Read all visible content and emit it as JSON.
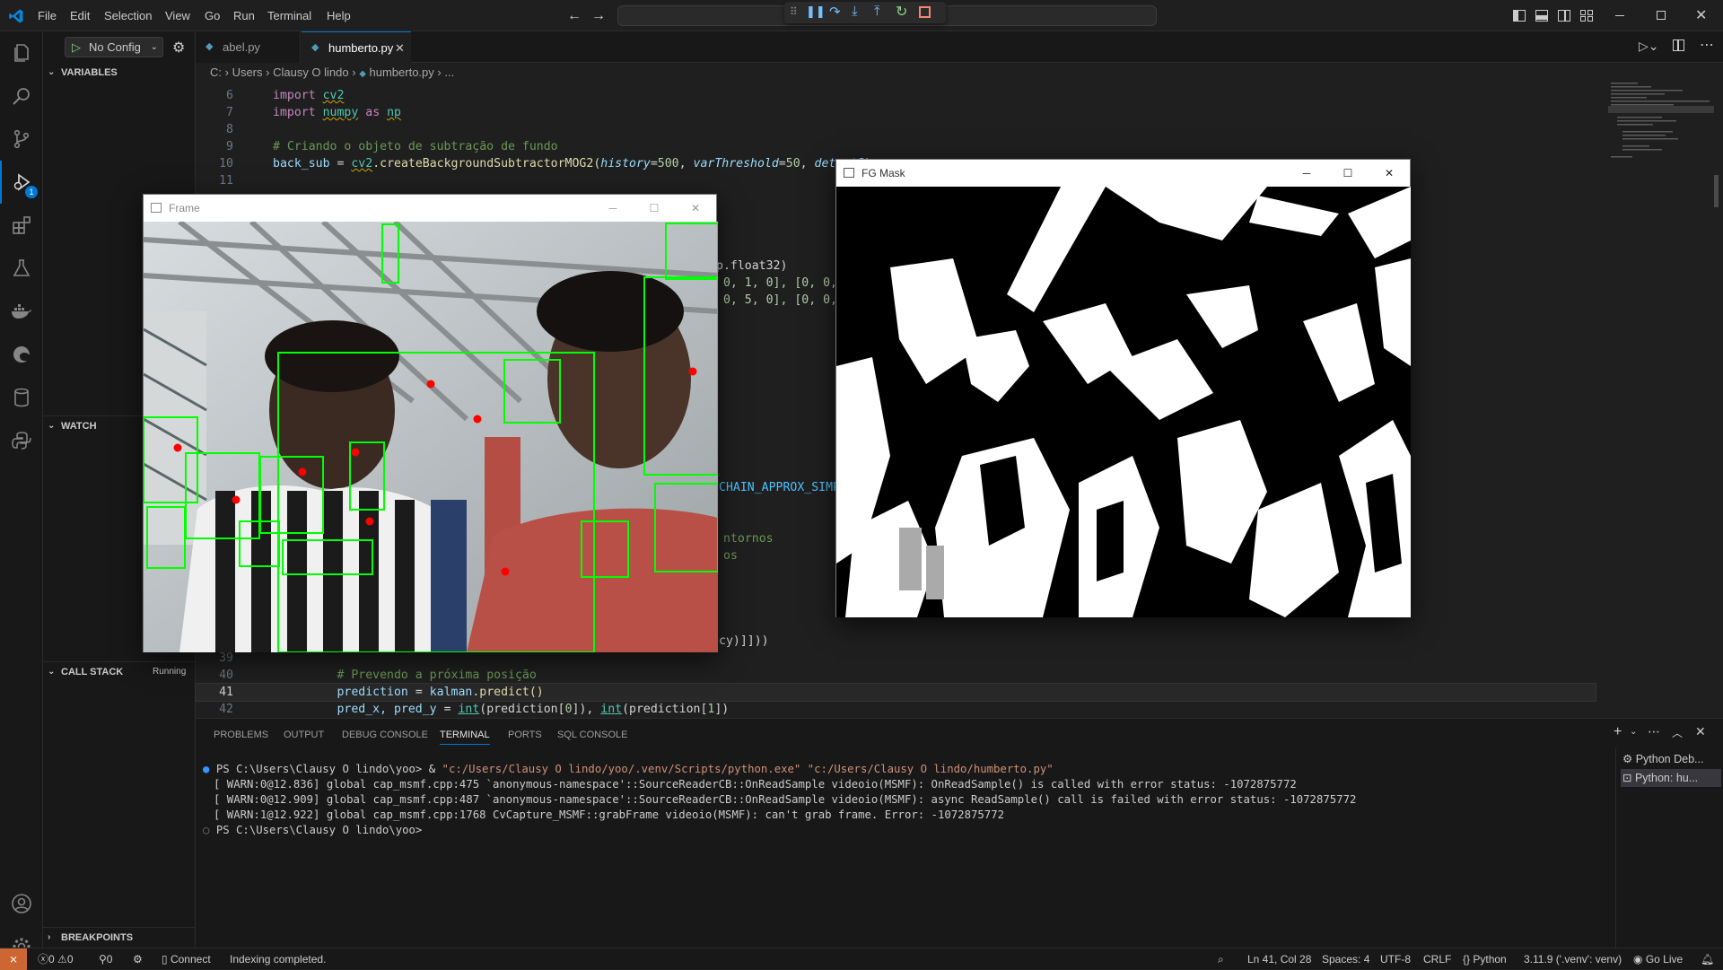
{
  "menu": [
    "File",
    "Edit",
    "Selection",
    "View",
    "Go",
    "Run",
    "Terminal",
    "Help"
  ],
  "run_config": {
    "label": "No Config"
  },
  "tabs": [
    {
      "label": "abel.py"
    },
    {
      "label": "humberto.py"
    }
  ],
  "breadcrumb": {
    "parts": [
      "C:",
      "Users",
      "Clausy O lindo",
      "humberto.py",
      "..."
    ]
  },
  "sidebar": {
    "variables": "VARIABLES",
    "watch": "WATCH",
    "call_stack": "CALL STACK",
    "call_stack_status": "Running",
    "breakpoints": "BREAKPOINTS"
  },
  "activity_badge": "1",
  "code": {
    "l6": {
      "n": "6",
      "kw": "import",
      "mod": "cv2"
    },
    "l7": {
      "n": "7",
      "kw": "import",
      "mod": "numpy",
      "as": "as",
      "alias": "np"
    },
    "l8": {
      "n": "8"
    },
    "l9": {
      "n": "9",
      "text": "# Criando o objeto de subtração de fundo"
    },
    "l10": {
      "n": "10",
      "var": "back_sub",
      "eq": " = ",
      "obj": "cv2",
      "fn": ".createBackgroundSubtractorMOG2(",
      "p1": "history",
      "v1": "500",
      "p2": "varThreshold",
      "v2": "50",
      "p3": "detectSh"
    },
    "l11": {
      "n": "11"
    },
    "frag1": "p.float32)",
    "frag2": " 0, 1, 0], [0, 0,",
    "frag3": " 0, 5, 0], [0, 0, ",
    "frag4": "CHAIN_APPROX_SIMP",
    "frag5": "ntornos",
    "frag6": "os",
    "frag7": "cy)]]))",
    "l39": {
      "n": "39"
    },
    "l40": {
      "n": "40",
      "text": "# Prevendo a próxima posição"
    },
    "l41": {
      "n": "41",
      "var": "prediction",
      "obj": "kalman",
      "fn": ".predict()"
    },
    "l42": {
      "n": "42",
      "a": "pred_x, pred_y",
      "f1": "int",
      "b": "(prediction[",
      "i0": "0",
      "c": "]), ",
      "f2": "int",
      "d": "(prediction[",
      "i1": "1",
      "e": "])"
    }
  },
  "panel": {
    "tabs": [
      "PROBLEMS",
      "OUTPUT",
      "DEBUG CONSOLE",
      "TERMINAL",
      "PORTS",
      "SQL CONSOLE"
    ],
    "active": "TERMINAL",
    "terminal": {
      "prompt1": "PS C:\\Users\\Clausy O lindo\\yoo> ",
      "cmd_amp": "& ",
      "cmd_exe": "\"c:/Users/Clausy O lindo/yoo/.venv/Scripts/python.exe\"",
      "cmd_arg": " \"c:/Users/Clausy O lindo/humberto.py\"",
      "warn1": "[ WARN:0@12.836] global cap_msmf.cpp:475 `anonymous-namespace'::SourceReaderCB::OnReadSample videoio(MSMF): OnReadSample() is called with error status: -1072875772",
      "warn2": "[ WARN:0@12.909] global cap_msmf.cpp:487 `anonymous-namespace'::SourceReaderCB::OnReadSample videoio(MSMF): async ReadSample() call is failed with error status: -1072875772",
      "warn3": "[ WARN:1@12.922] global cap_msmf.cpp:1768 CvCapture_MSMF::grabFrame videoio(MSMF): can't grab frame. Error: -1072875772",
      "prompt2": "PS C:\\Users\\Clausy O lindo\\yoo>"
    },
    "terminal_list": [
      "Python Deb...",
      "Python: hu..."
    ]
  },
  "status": {
    "errors": "0",
    "warnings": "0",
    "ports": "0",
    "connect": "Connect",
    "indexing": "Indexing completed.",
    "position": "Ln 41, Col 28",
    "spaces": "Spaces: 4",
    "encoding": "UTF-8",
    "eol": "CRLF",
    "language": "Python",
    "interpreter": "3.11.9 ('.venv': venv)",
    "golive": "Go Live"
  },
  "windows": {
    "frame_title": "Frame",
    "mask_title": "FG Mask"
  },
  "colors": {
    "accent": "#0078d4",
    "bg": "#1f1f1f",
    "keyword": "#c586c0",
    "module": "#4ec9b0",
    "comment": "#6a9955",
    "box": "#00ff00",
    "dot": "#ff0000"
  }
}
